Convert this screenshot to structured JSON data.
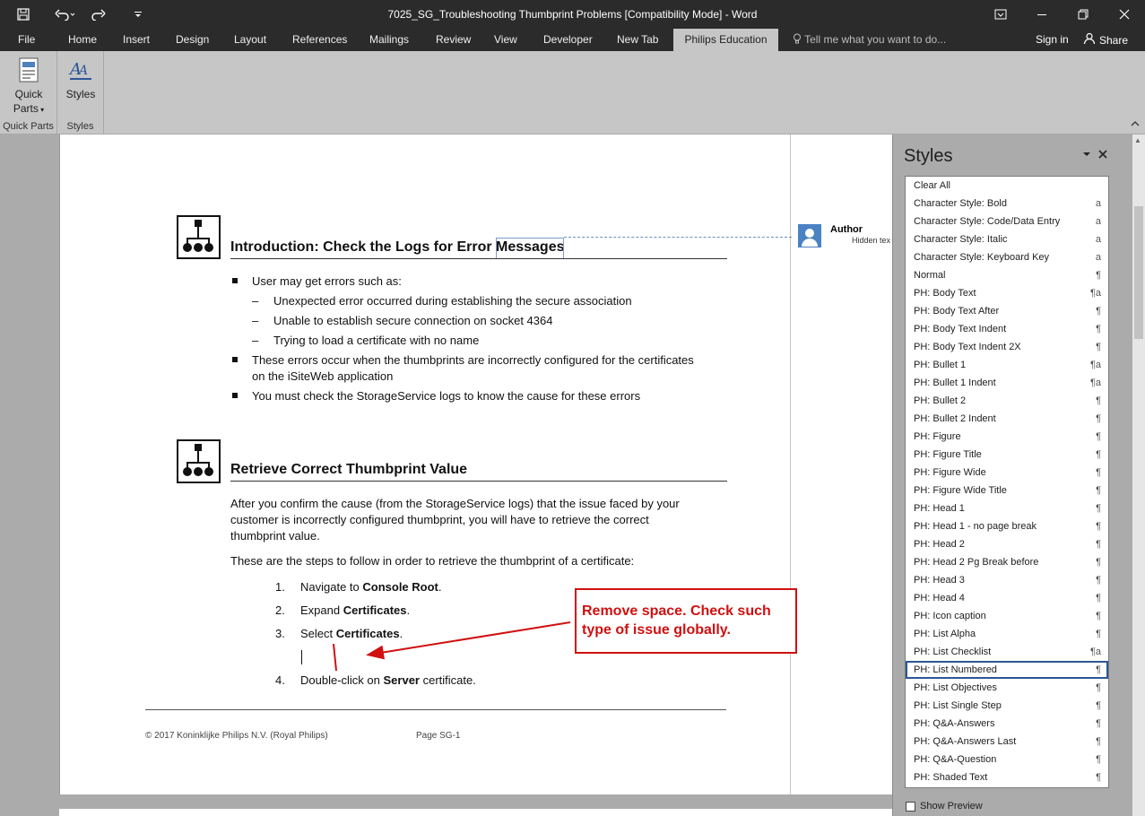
{
  "window": {
    "title": "7025_SG_Troubleshooting Thumbprint Problems [Compatibility Mode] - Word",
    "qat_icons": [
      "save-icon",
      "undo-icon",
      "redo-icon",
      "customize-icon"
    ],
    "controls": [
      "ribbon-display-icon",
      "minimize-icon",
      "restore-icon",
      "close-icon"
    ]
  },
  "tabs": [
    "File",
    "Home",
    "Insert",
    "Design",
    "Layout",
    "References",
    "Mailings",
    "Review",
    "View",
    "Developer",
    "New Tab",
    "Philips Education"
  ],
  "active_tab": "Philips Education",
  "tell_me": "Tell me what you want to do...",
  "sign_in": "Sign in",
  "share": "Share",
  "ribbon": {
    "quick_parts_line1": "Quick",
    "quick_parts_line2": "Parts",
    "styles_btn": "Styles",
    "group_quick_parts": "Quick Parts",
    "group_styles": "Styles"
  },
  "document": {
    "heading1": "Introduction: Check the Logs for Error Messages",
    "bullets": [
      "User may get errors such as:",
      "These errors occur when the thumbprints are incorrectly configured for the certificates",
      "You must check the StorageService logs to know the cause for these errors"
    ],
    "bullet2_line2": "on the iSiteWeb application",
    "sub_items": [
      "Unexpected error occurred during establishing the secure association",
      "Unable to establish secure connection on socket 4364",
      "Trying to load a certificate with no name"
    ],
    "dash": "–",
    "heading2": "Retrieve Correct Thumbprint Value",
    "para1": [
      "After you confirm the cause (from the StorageService logs) that the issue faced by your",
      "customer is incorrectly configured thumbprint, you will have to retrieve the correct",
      "thumbprint value."
    ],
    "para2": "These are the steps to follow in order to retrieve the thumbprint of a certificate:",
    "steps": [
      {
        "num": "1.",
        "pre": "Navigate to ",
        "bold": "Console Root",
        "post": "."
      },
      {
        "num": "2.",
        "pre": "Expand ",
        "bold": "Certificates",
        "post": "."
      },
      {
        "num": "3.",
        "pre": "Select ",
        "bold": "Certificates",
        "post": "."
      },
      {
        "num": "4.",
        "pre": "Double-click on ",
        "bold": "Server",
        "post": " certificate."
      }
    ],
    "footer_left": "© 2017 Koninklijke Philips N.V. (Royal Philips)",
    "footer_page": "Page SG-1"
  },
  "comment": {
    "author": "Author",
    "text": "Hidden tex"
  },
  "callout": "Remove space. Check such type of issue globally.",
  "styles_pane": {
    "title": "Styles",
    "items": [
      {
        "name": "Clear All",
        "marker": ""
      },
      {
        "name": "Character Style: Bold",
        "marker": "a"
      },
      {
        "name": "Character Style: Code/Data Entry",
        "marker": "a"
      },
      {
        "name": "Character Style: Italic",
        "marker": "a"
      },
      {
        "name": "Character Style: Keyboard Key",
        "marker": "a"
      },
      {
        "name": "Normal",
        "marker": "¶"
      },
      {
        "name": "PH: Body Text",
        "marker": "¶a"
      },
      {
        "name": "PH: Body Text After",
        "marker": "¶"
      },
      {
        "name": "PH: Body Text Indent",
        "marker": "¶"
      },
      {
        "name": "PH: Body Text Indent 2X",
        "marker": "¶"
      },
      {
        "name": "PH: Bullet 1",
        "marker": "¶a"
      },
      {
        "name": "PH: Bullet 1 Indent",
        "marker": "¶a"
      },
      {
        "name": "PH: Bullet 2",
        "marker": "¶"
      },
      {
        "name": "PH: Bullet 2 Indent",
        "marker": "¶"
      },
      {
        "name": "PH: Figure",
        "marker": "¶"
      },
      {
        "name": "PH: Figure Title",
        "marker": "¶"
      },
      {
        "name": "PH: Figure Wide",
        "marker": "¶"
      },
      {
        "name": "PH: Figure Wide Title",
        "marker": "¶"
      },
      {
        "name": "PH: Head 1",
        "marker": "¶"
      },
      {
        "name": "PH: Head 1 - no page break",
        "marker": "¶"
      },
      {
        "name": "PH: Head 2",
        "marker": "¶"
      },
      {
        "name": "PH: Head 2 Pg Break before",
        "marker": "¶"
      },
      {
        "name": "PH: Head 3",
        "marker": "¶"
      },
      {
        "name": "PH: Head 4",
        "marker": "¶"
      },
      {
        "name": "PH: Icon caption",
        "marker": "¶"
      },
      {
        "name": "PH: List Alpha",
        "marker": "¶"
      },
      {
        "name": "PH: List Checklist",
        "marker": "¶a"
      },
      {
        "name": "PH: List Numbered",
        "marker": "¶"
      },
      {
        "name": "PH: List Objectives",
        "marker": "¶"
      },
      {
        "name": "PH: List Single Step",
        "marker": "¶"
      },
      {
        "name": "PH: Q&A-Answers",
        "marker": "¶"
      },
      {
        "name": "PH: Q&A-Answers Last",
        "marker": "¶"
      },
      {
        "name": "PH: Q&A-Question",
        "marker": "¶"
      },
      {
        "name": "PH: Shaded Text",
        "marker": "¶"
      }
    ],
    "selected": "PH: List Numbered",
    "show_preview": "Show Preview"
  }
}
